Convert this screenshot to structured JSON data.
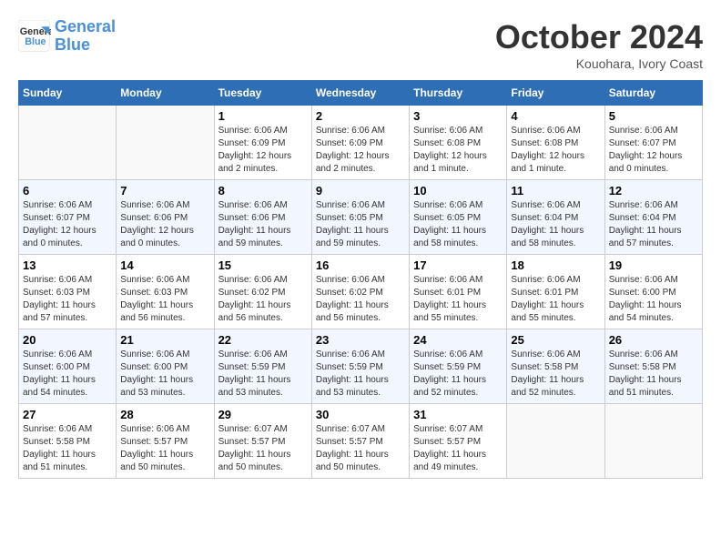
{
  "header": {
    "logo_line1": "General",
    "logo_line2": "Blue",
    "month": "October 2024",
    "location": "Kouohara, Ivory Coast"
  },
  "weekdays": [
    "Sunday",
    "Monday",
    "Tuesday",
    "Wednesday",
    "Thursday",
    "Friday",
    "Saturday"
  ],
  "weeks": [
    [
      {
        "day": "",
        "info": ""
      },
      {
        "day": "",
        "info": ""
      },
      {
        "day": "1",
        "info": "Sunrise: 6:06 AM\nSunset: 6:09 PM\nDaylight: 12 hours and 2 minutes."
      },
      {
        "day": "2",
        "info": "Sunrise: 6:06 AM\nSunset: 6:09 PM\nDaylight: 12 hours and 2 minutes."
      },
      {
        "day": "3",
        "info": "Sunrise: 6:06 AM\nSunset: 6:08 PM\nDaylight: 12 hours and 1 minute."
      },
      {
        "day": "4",
        "info": "Sunrise: 6:06 AM\nSunset: 6:08 PM\nDaylight: 12 hours and 1 minute."
      },
      {
        "day": "5",
        "info": "Sunrise: 6:06 AM\nSunset: 6:07 PM\nDaylight: 12 hours and 0 minutes."
      }
    ],
    [
      {
        "day": "6",
        "info": "Sunrise: 6:06 AM\nSunset: 6:07 PM\nDaylight: 12 hours and 0 minutes."
      },
      {
        "day": "7",
        "info": "Sunrise: 6:06 AM\nSunset: 6:06 PM\nDaylight: 12 hours and 0 minutes."
      },
      {
        "day": "8",
        "info": "Sunrise: 6:06 AM\nSunset: 6:06 PM\nDaylight: 11 hours and 59 minutes."
      },
      {
        "day": "9",
        "info": "Sunrise: 6:06 AM\nSunset: 6:05 PM\nDaylight: 11 hours and 59 minutes."
      },
      {
        "day": "10",
        "info": "Sunrise: 6:06 AM\nSunset: 6:05 PM\nDaylight: 11 hours and 58 minutes."
      },
      {
        "day": "11",
        "info": "Sunrise: 6:06 AM\nSunset: 6:04 PM\nDaylight: 11 hours and 58 minutes."
      },
      {
        "day": "12",
        "info": "Sunrise: 6:06 AM\nSunset: 6:04 PM\nDaylight: 11 hours and 57 minutes."
      }
    ],
    [
      {
        "day": "13",
        "info": "Sunrise: 6:06 AM\nSunset: 6:03 PM\nDaylight: 11 hours and 57 minutes."
      },
      {
        "day": "14",
        "info": "Sunrise: 6:06 AM\nSunset: 6:03 PM\nDaylight: 11 hours and 56 minutes."
      },
      {
        "day": "15",
        "info": "Sunrise: 6:06 AM\nSunset: 6:02 PM\nDaylight: 11 hours and 56 minutes."
      },
      {
        "day": "16",
        "info": "Sunrise: 6:06 AM\nSunset: 6:02 PM\nDaylight: 11 hours and 56 minutes."
      },
      {
        "day": "17",
        "info": "Sunrise: 6:06 AM\nSunset: 6:01 PM\nDaylight: 11 hours and 55 minutes."
      },
      {
        "day": "18",
        "info": "Sunrise: 6:06 AM\nSunset: 6:01 PM\nDaylight: 11 hours and 55 minutes."
      },
      {
        "day": "19",
        "info": "Sunrise: 6:06 AM\nSunset: 6:00 PM\nDaylight: 11 hours and 54 minutes."
      }
    ],
    [
      {
        "day": "20",
        "info": "Sunrise: 6:06 AM\nSunset: 6:00 PM\nDaylight: 11 hours and 54 minutes."
      },
      {
        "day": "21",
        "info": "Sunrise: 6:06 AM\nSunset: 6:00 PM\nDaylight: 11 hours and 53 minutes."
      },
      {
        "day": "22",
        "info": "Sunrise: 6:06 AM\nSunset: 5:59 PM\nDaylight: 11 hours and 53 minutes."
      },
      {
        "day": "23",
        "info": "Sunrise: 6:06 AM\nSunset: 5:59 PM\nDaylight: 11 hours and 53 minutes."
      },
      {
        "day": "24",
        "info": "Sunrise: 6:06 AM\nSunset: 5:59 PM\nDaylight: 11 hours and 52 minutes."
      },
      {
        "day": "25",
        "info": "Sunrise: 6:06 AM\nSunset: 5:58 PM\nDaylight: 11 hours and 52 minutes."
      },
      {
        "day": "26",
        "info": "Sunrise: 6:06 AM\nSunset: 5:58 PM\nDaylight: 11 hours and 51 minutes."
      }
    ],
    [
      {
        "day": "27",
        "info": "Sunrise: 6:06 AM\nSunset: 5:58 PM\nDaylight: 11 hours and 51 minutes."
      },
      {
        "day": "28",
        "info": "Sunrise: 6:06 AM\nSunset: 5:57 PM\nDaylight: 11 hours and 50 minutes."
      },
      {
        "day": "29",
        "info": "Sunrise: 6:07 AM\nSunset: 5:57 PM\nDaylight: 11 hours and 50 minutes."
      },
      {
        "day": "30",
        "info": "Sunrise: 6:07 AM\nSunset: 5:57 PM\nDaylight: 11 hours and 50 minutes."
      },
      {
        "day": "31",
        "info": "Sunrise: 6:07 AM\nSunset: 5:57 PM\nDaylight: 11 hours and 49 minutes."
      },
      {
        "day": "",
        "info": ""
      },
      {
        "day": "",
        "info": ""
      }
    ]
  ]
}
